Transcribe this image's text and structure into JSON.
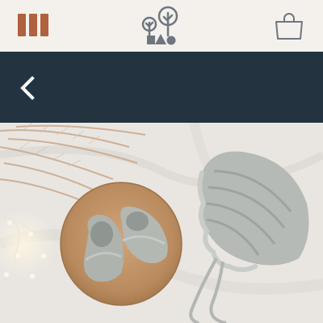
{
  "header": {
    "menu_icon": "hamburger-bars-icon",
    "logo_icon": "tree-house-logo-icon",
    "cart_icon": "shopping-bag-icon",
    "menu_color": "#b0613e",
    "logo_color": "#6e7780"
  },
  "subheader": {
    "back_icon": "chevron-left-icon",
    "background": "#233340"
  },
  "hero": {
    "image": "photo-crochet-baby-shoes-and-bonnet"
  }
}
